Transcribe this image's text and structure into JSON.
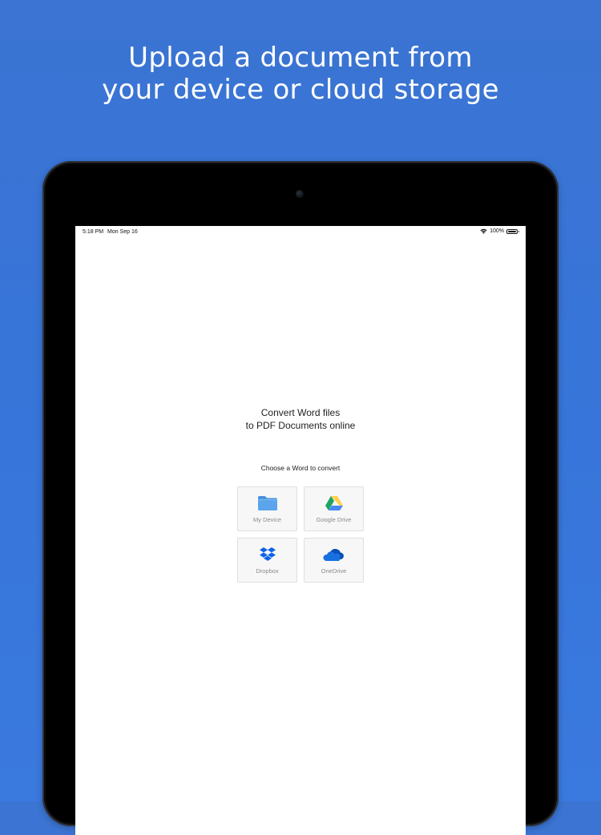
{
  "promo": {
    "headline_line1": "Upload a document from",
    "headline_line2": "your device or cloud storage"
  },
  "status_bar": {
    "time": "5:18 PM",
    "date": "Mon Sep 16",
    "battery": "100%",
    "battery_level": 1.0
  },
  "app": {
    "title_line1": "Convert Word files",
    "title_line2": "to PDF Documents online",
    "prompt": "Choose a Word to convert",
    "sources": [
      {
        "label": "My Device",
        "icon": "folder-icon"
      },
      {
        "label": "Google Drive",
        "icon": "google-drive-icon"
      },
      {
        "label": "Dropbox",
        "icon": "dropbox-icon"
      },
      {
        "label": "OneDrive",
        "icon": "onedrive-icon"
      }
    ]
  },
  "colors": {
    "background": "#3775da",
    "folder": "#5aa5ec",
    "drive_green": "#1fa463",
    "drive_yellow": "#ffd04b",
    "drive_blue": "#4688f4",
    "dropbox": "#0d63e6",
    "onedrive": "#0a50b8"
  }
}
